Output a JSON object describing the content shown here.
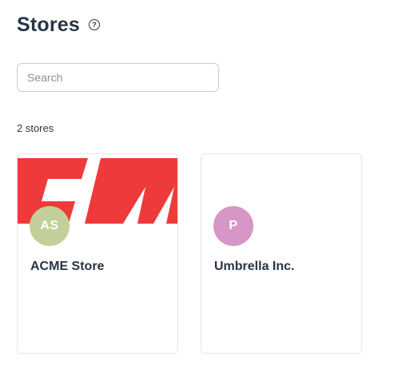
{
  "header": {
    "title": "Stores",
    "help_icon": "?"
  },
  "search": {
    "placeholder": "Search",
    "value": ""
  },
  "summary": {
    "count_text": "2 stores"
  },
  "stores": [
    {
      "name": "ACME Store",
      "initials": "AS",
      "avatar_color": "#c3d09a",
      "banner_color": "#ee3a3a",
      "banner_text": "CM"
    },
    {
      "name": "Umbrella Inc.",
      "initials": "P",
      "avatar_color": "#d696c6"
    }
  ]
}
